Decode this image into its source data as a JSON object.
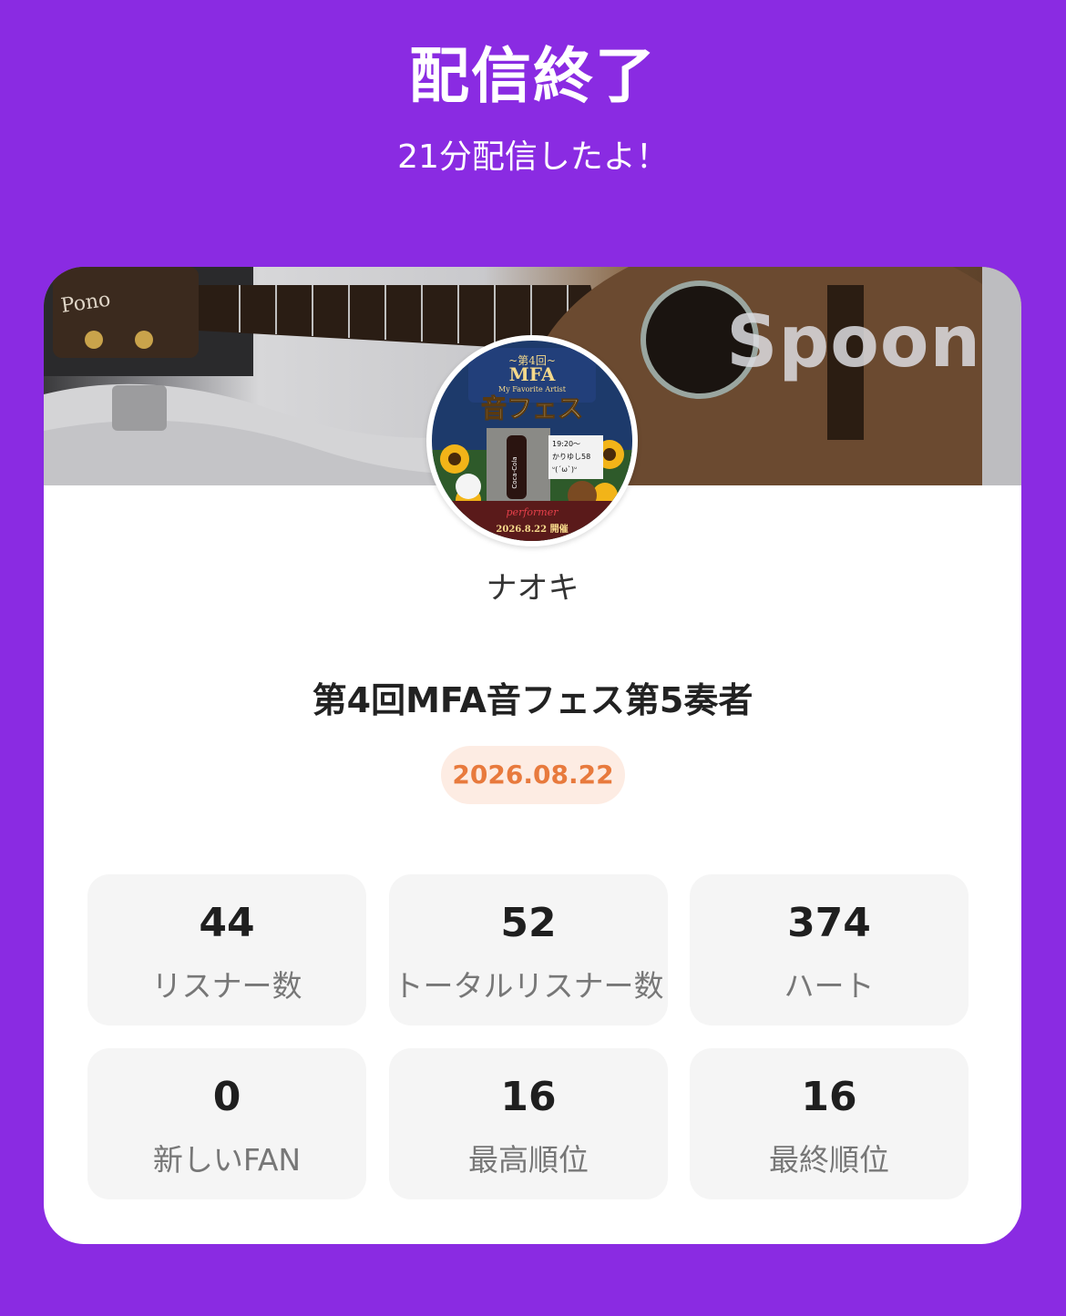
{
  "header": {
    "title": "配信終了",
    "subtitle": "21分配信したよ！"
  },
  "card": {
    "brand": "Spoon",
    "avatar_icon": "event-poster-avatar",
    "poster": {
      "line1": "~第4回~",
      "line2": "MFA",
      "line3": "My Favorite Artist",
      "line4": "音フェス",
      "time": "19:20～",
      "name": "かりゆし58",
      "face": "ᐡ(ˊωˋ)ᐡ",
      "date": "2026.8.22 開催",
      "bottle": "Coca-Cola",
      "performer": "performer"
    },
    "username": "ナオキ",
    "live_title": "第4回MFA音フェス第5奏者",
    "date": "2026.08.22",
    "date_colors": {
      "bg": "#fdece3",
      "text": "#e87a3d"
    }
  },
  "stats": [
    {
      "value": "44",
      "label": "リスナー数"
    },
    {
      "value": "52",
      "label": "トータルリスナー数"
    },
    {
      "value": "374",
      "label": "ハート"
    },
    {
      "value": "0",
      "label": "新しいFAN"
    },
    {
      "value": "16",
      "label": "最高順位"
    },
    {
      "value": "16",
      "label": "最終順位"
    }
  ],
  "colors": {
    "background": "#8a2be2",
    "card": "#ffffff",
    "stat_bg": "#f5f5f5"
  }
}
